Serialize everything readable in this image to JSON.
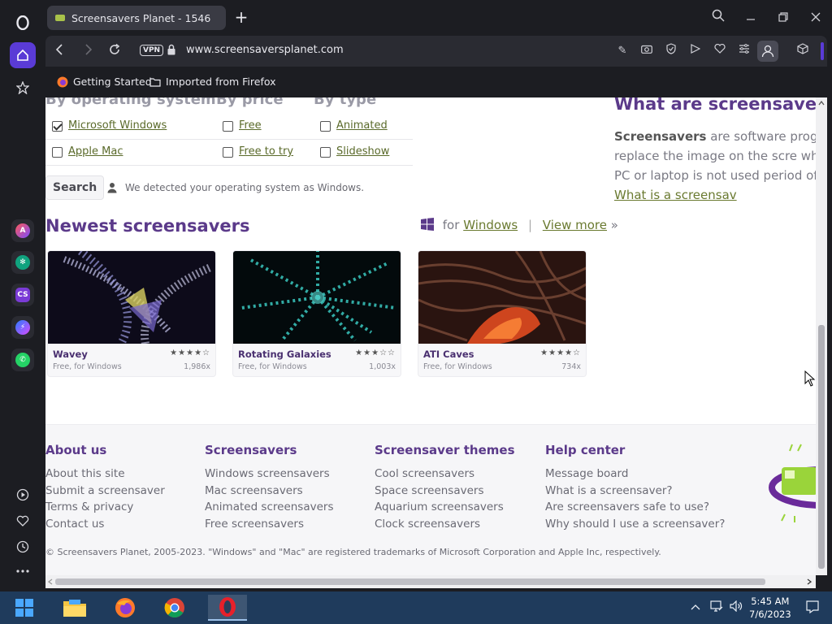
{
  "browser": {
    "tab_title": "Screensavers Planet - 1546",
    "url": "www.screensaversplanet.com",
    "vpn_label": "VPN",
    "bookmarks": [
      "Getting Started",
      "Imported from Firefox"
    ]
  },
  "page": {
    "filters": {
      "heads": [
        "By operating system",
        "By price",
        "By type"
      ],
      "rows": [
        {
          "os": "Microsoft Windows",
          "os_checked": true,
          "price": "Free",
          "type": "Animated"
        },
        {
          "os": "Apple Mac",
          "os_checked": false,
          "price": "Free to try",
          "type": "Slideshow"
        }
      ],
      "search_label": "Search",
      "detected_text": "We detected your operating system as Windows."
    },
    "newest": {
      "title": "Newest screensavers",
      "for_label": "for",
      "os_link": "Windows",
      "separator": "|",
      "view_more": "View more",
      "view_more_arrow": "»",
      "cards": [
        {
          "title": "Wavey",
          "sub": "Free, for Windows",
          "count": "1,986x",
          "stars": "★★★★☆"
        },
        {
          "title": "Rotating Galaxies",
          "sub": "Free, for Windows",
          "count": "1,003x",
          "stars": "★★★☆☆"
        },
        {
          "title": "ATI Caves",
          "sub": "Free, for Windows",
          "count": "734x",
          "stars": "★★★★☆"
        }
      ]
    },
    "what": {
      "title": "What are screensavers?",
      "bold": "Screensavers",
      "body": " are software progra that replace the image on the scre when your PC or laptop is not used period of time. ",
      "link": "What is a screensav"
    },
    "footer": {
      "cols": [
        {
          "head": "About us",
          "items": [
            "About this site",
            "Submit a screensaver",
            "Terms & privacy",
            "Contact us"
          ]
        },
        {
          "head": "Screensavers",
          "items": [
            "Windows screensavers",
            "Mac screensavers",
            "Animated screensavers",
            "Free screensavers"
          ]
        },
        {
          "head": "Screensaver themes",
          "items": [
            "Cool screensavers",
            "Space screensavers",
            "Aquarium screensavers",
            "Clock screensavers"
          ]
        },
        {
          "head": "Help center",
          "items": [
            "Message board",
            "What is a screensaver?",
            "Are screensavers safe to use?",
            "Why should I use a screensaver?"
          ]
        }
      ],
      "copyright": "© Screensavers Planet, 2005-2023. \"Windows\" and \"Mac\" are registered trademarks of Microsoft Corporation and Apple Inc, respectively."
    }
  },
  "taskbar": {
    "time": "5:45 AM",
    "date": "7/6/2023"
  }
}
